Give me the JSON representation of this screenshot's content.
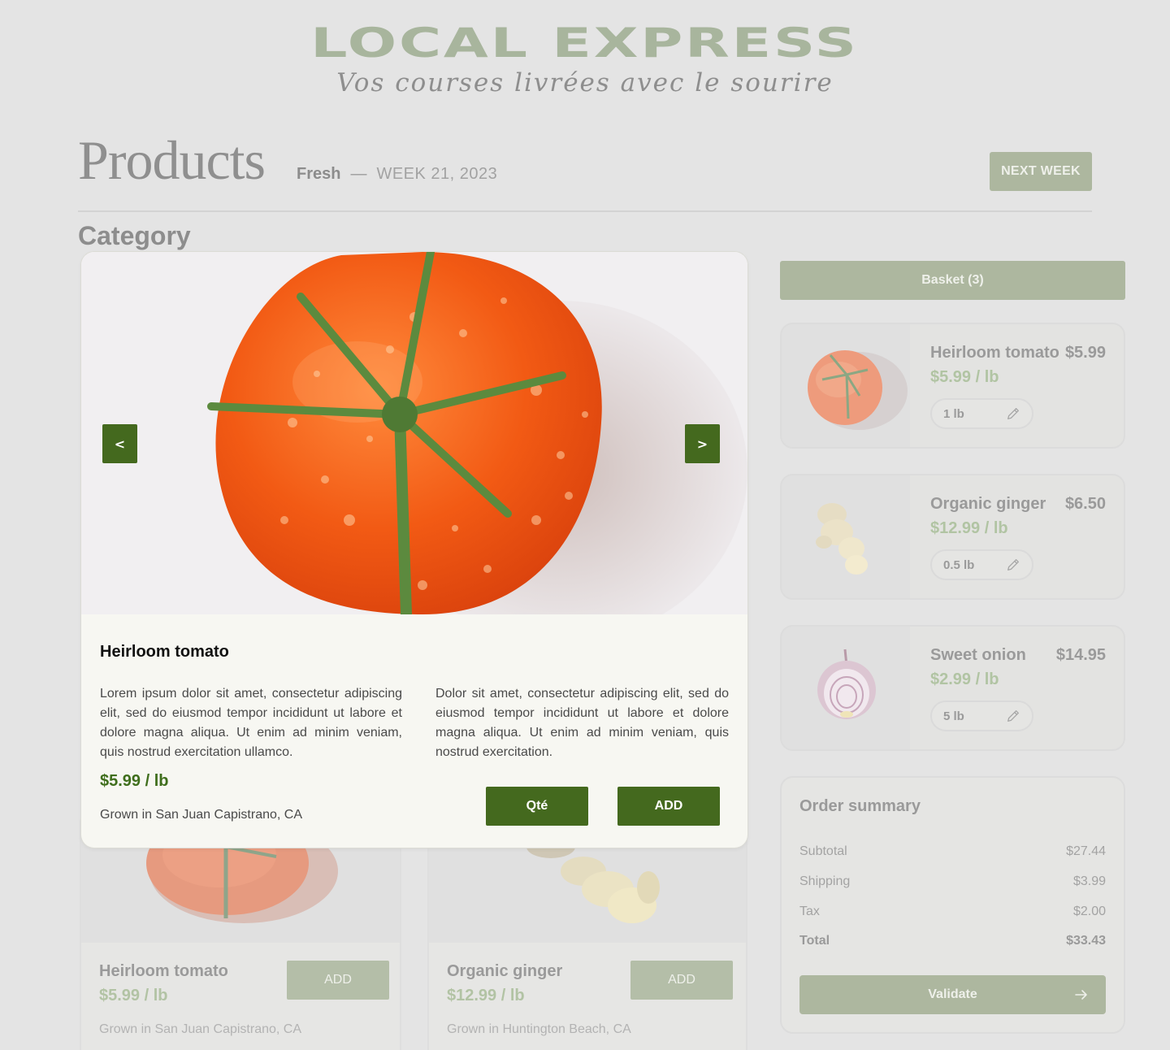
{
  "brand": {
    "title": "LOCAL EXPRESS",
    "tagline": "Vos courses livrées avec le sourire",
    "color": "#a8b59d"
  },
  "header": {
    "title": "Products",
    "subtitle_fresh": "Fresh",
    "subtitle_dash": "—",
    "subtitle_week": "WEEK 21, 2023",
    "next_week_label": "NEXT WEEK"
  },
  "category": {
    "label": "Category"
  },
  "modal": {
    "image_icon": "tomato-photo",
    "prev_label": "<",
    "next_label": ">",
    "product_name": "Heirloom tomato",
    "description_1": "Lorem ipsum dolor sit amet, consectetur adipiscing elit, sed do eiusmod tempor incididunt ut labore et dolore magna aliqua. Ut enim ad minim veniam, quis nostrud exercitation ullamco.",
    "description_2": "Dolor sit amet, consectetur adipiscing elit, sed do eiusmod tempor incididunt ut labore et dolore magna aliqua. Ut enim ad minim veniam, quis nostrud exercitation.",
    "price": "$5.99 / lb",
    "origin": "Grown in San Juan Capistrano, CA",
    "qty_label": "Qté",
    "add_label": "ADD",
    "accent": "#44691e"
  },
  "products": [
    {
      "name": "Heirloom tomato",
      "price": "$5.99 / lb",
      "origin": "Grown in San Juan Capistrano, CA",
      "add_label": "ADD",
      "icon": "tomato-image"
    },
    {
      "name": "Organic ginger",
      "price": "$12.99 / lb",
      "origin": "Grown in Huntington Beach, CA",
      "add_label": "ADD",
      "icon": "ginger-image"
    }
  ],
  "basket": {
    "header_label": "Basket (3)",
    "items": [
      {
        "name": "Heirloom tomato",
        "total": "$5.99",
        "unit_price": "$5.99 / lb",
        "quantity": "1 lb",
        "icon": "tomato-image"
      },
      {
        "name": "Organic ginger",
        "total": "$6.50",
        "unit_price": "$12.99 / lb",
        "quantity": "0.5 lb",
        "icon": "ginger-image"
      },
      {
        "name": "Sweet onion",
        "total": "$14.95",
        "unit_price": "$2.99 / lb",
        "quantity": "5 lb",
        "icon": "onion-image"
      }
    ]
  },
  "summary": {
    "title": "Order summary",
    "rows": [
      {
        "label": "Subtotal",
        "value": "$27.44"
      },
      {
        "label": "Shipping",
        "value": "$3.99"
      },
      {
        "label": "Tax",
        "value": "$2.00"
      },
      {
        "label": "Total",
        "value": "$33.43"
      }
    ],
    "validate_label": "Validate"
  }
}
